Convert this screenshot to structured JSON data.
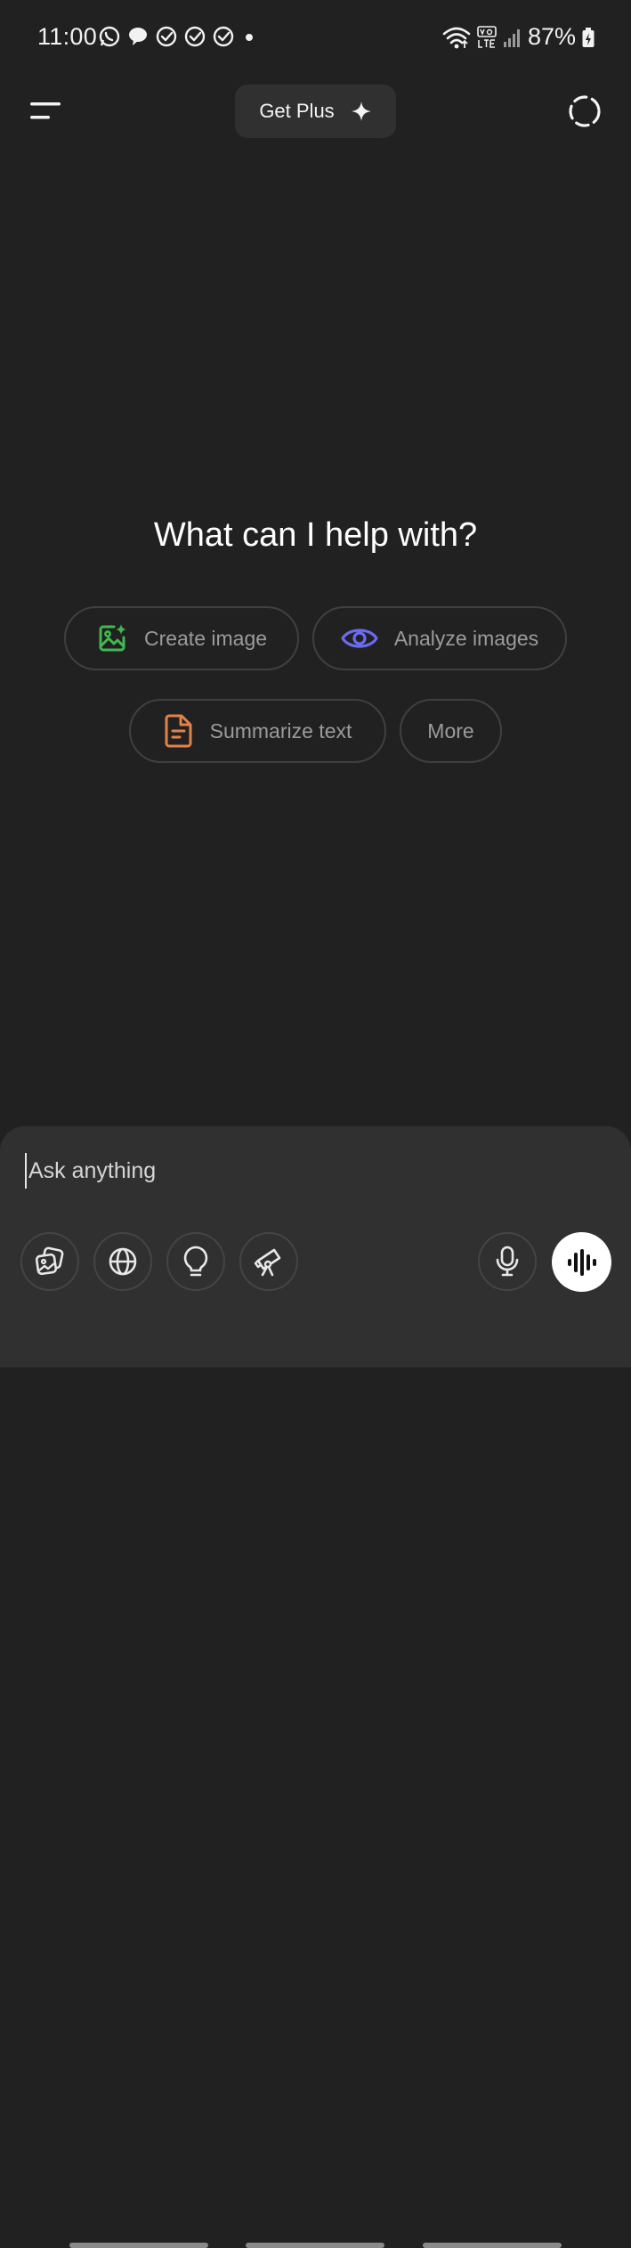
{
  "status_bar": {
    "time": "11:00",
    "battery": "87%"
  },
  "header": {
    "get_plus_label": "Get Plus"
  },
  "main": {
    "heading": "What can I help with?",
    "chips": [
      {
        "label": "Create image",
        "icon": "image-sparkle-icon",
        "color": "#3fb950"
      },
      {
        "label": "Analyze images",
        "icon": "eye-icon",
        "color": "#6b6bf0"
      },
      {
        "label": "Summarize text",
        "icon": "document-icon",
        "color": "#e0834a"
      },
      {
        "label": "More",
        "icon": ""
      }
    ]
  },
  "composer": {
    "placeholder": "Ask anything",
    "tools": [
      "photos-icon",
      "globe-icon",
      "lightbulb-icon",
      "telescope-icon",
      "microphone-icon",
      "voice-waveform-icon"
    ]
  }
}
